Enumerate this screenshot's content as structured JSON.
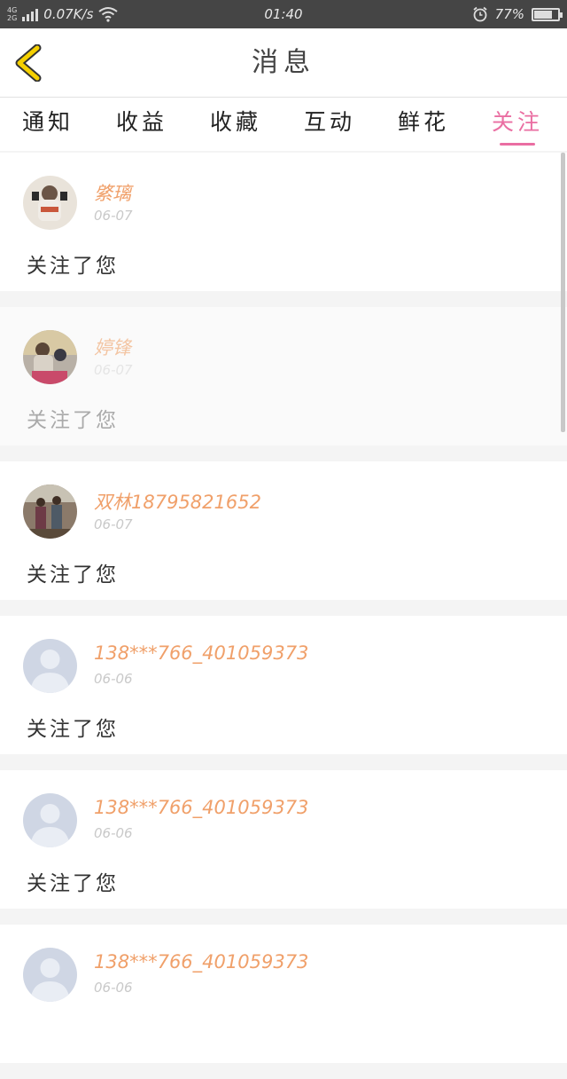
{
  "status_bar": {
    "network_top": "4G",
    "network_bottom": "2G",
    "speed": "0.07K/s",
    "time": "01:40",
    "battery_text": "77%",
    "battery_level": 0.77
  },
  "header": {
    "title": "消息",
    "back_icon": "chevron-left-icon",
    "back_color": "#f5d000"
  },
  "tabs": [
    {
      "label": "通知",
      "active": false
    },
    {
      "label": "收益",
      "active": false
    },
    {
      "label": "收藏",
      "active": false
    },
    {
      "label": "互动",
      "active": false
    },
    {
      "label": "鲜花",
      "active": false
    },
    {
      "label": "关注",
      "active": true
    }
  ],
  "accent_color": "#ea6ea2",
  "messages": [
    {
      "username": "綮璃",
      "date": "06-07",
      "text": "关注了您",
      "avatar": "photo"
    },
    {
      "username": "婷锋",
      "date": "06-07",
      "text": "关注了您",
      "avatar": "photo"
    },
    {
      "username": "双林18795821652",
      "date": "06-07",
      "text": "关注了您",
      "avatar": "photo"
    },
    {
      "username": "138***766_401059373",
      "date": "06-06",
      "text": "关注了您",
      "avatar": "default-avatar-icon"
    },
    {
      "username": "138***766_401059373",
      "date": "06-06",
      "text": "关注了您",
      "avatar": "default-avatar-icon"
    },
    {
      "username": "138***766_401059373",
      "date": "06-06",
      "text": "",
      "avatar": "default-avatar-icon"
    }
  ]
}
